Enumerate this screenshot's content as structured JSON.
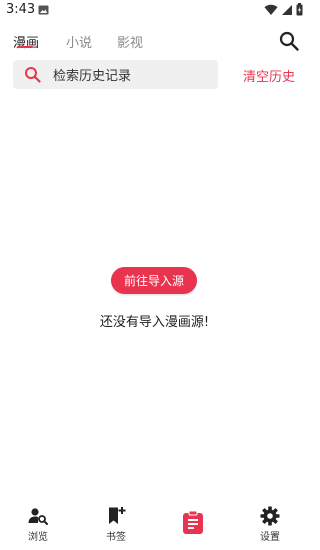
{
  "statusbar": {
    "time": "3:43"
  },
  "tabs": [
    {
      "label": "漫画"
    },
    {
      "label": "小说"
    },
    {
      "label": "影视"
    }
  ],
  "search": {
    "placeholder": "检索历史记录"
  },
  "clear_history_label": "清空历史",
  "goto_source_label": "前往导入源",
  "empty_message": "还没有导入漫画源!",
  "bottom_nav": [
    {
      "label": "浏览",
      "icon": "person-search-icon"
    },
    {
      "label": "书签",
      "icon": "bookmark-add-icon"
    },
    {
      "label": "",
      "icon": "clipboard-list-icon",
      "active": true
    },
    {
      "label": "设置",
      "icon": "gear-icon"
    }
  ],
  "colors": {
    "accent": "#e8344e",
    "searchbox_bg": "#f0f0f0"
  }
}
